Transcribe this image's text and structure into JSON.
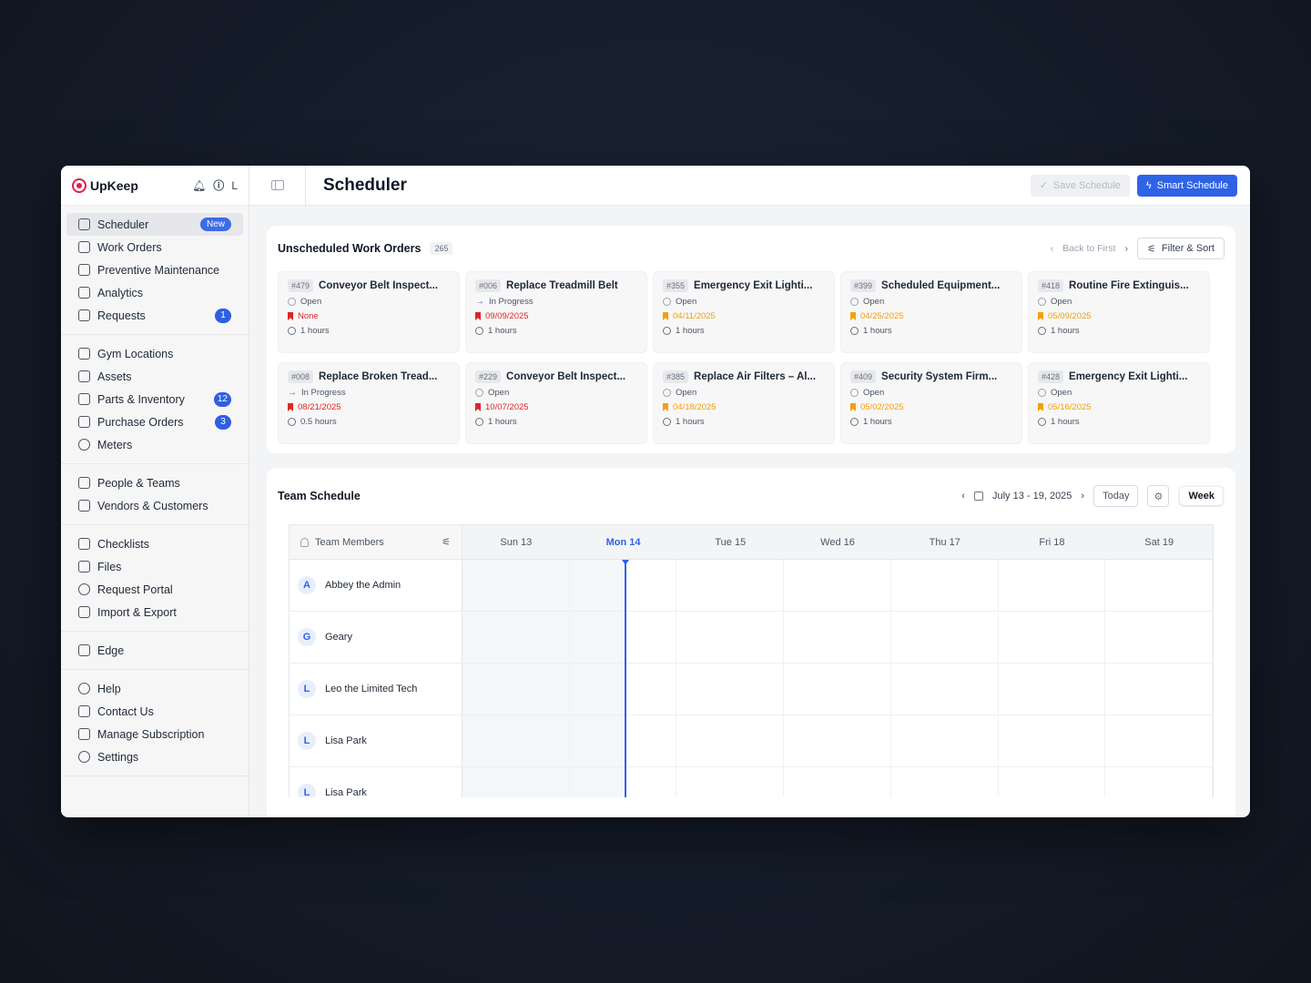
{
  "app": {
    "name": "UpKeep",
    "user_initial": "L"
  },
  "topbar": {
    "title": "Scheduler",
    "save_label": "Save Schedule",
    "smart_label": "Smart Schedule"
  },
  "sidebar": {
    "group1": [
      {
        "label": "Scheduler",
        "badge": "New",
        "active": true
      },
      {
        "label": "Work Orders"
      },
      {
        "label": "Preventive Maintenance"
      },
      {
        "label": "Analytics"
      },
      {
        "label": "Requests",
        "count": "1"
      }
    ],
    "group2": [
      {
        "label": "Gym Locations"
      },
      {
        "label": "Assets"
      },
      {
        "label": "Parts & Inventory",
        "count": "12"
      },
      {
        "label": "Purchase Orders",
        "count": "3"
      },
      {
        "label": "Meters"
      }
    ],
    "group3": [
      {
        "label": "People & Teams"
      },
      {
        "label": "Vendors & Customers"
      }
    ],
    "group4": [
      {
        "label": "Checklists"
      },
      {
        "label": "Files"
      },
      {
        "label": "Request Portal"
      },
      {
        "label": "Import & Export"
      }
    ],
    "group5": [
      {
        "label": "Edge"
      }
    ],
    "group6": [
      {
        "label": "Help"
      },
      {
        "label": "Contact Us"
      },
      {
        "label": "Manage Subscription"
      },
      {
        "label": "Settings"
      }
    ]
  },
  "unscheduled": {
    "title": "Unscheduled Work Orders",
    "count": "265",
    "back_label": "Back to First",
    "filter_label": "Filter & Sort",
    "orders": [
      {
        "id": "#479",
        "title": "Conveyor Belt Inspect...",
        "status": "Open",
        "due": "None",
        "due_color": "#dc2626",
        "hours": "1 hours"
      },
      {
        "id": "#006",
        "title": "Replace Treadmill Belt",
        "status": "In Progress",
        "due": "09/09/2025",
        "due_color": "#dc2626",
        "hours": "1 hours"
      },
      {
        "id": "#355",
        "title": "Emergency Exit Lighti...",
        "status": "Open",
        "due": "04/11/2025",
        "due_color": "#f59e0b",
        "hours": "1 hours"
      },
      {
        "id": "#399",
        "title": "Scheduled Equipment...",
        "status": "Open",
        "due": "04/25/2025",
        "due_color": "#f59e0b",
        "hours": "1 hours"
      },
      {
        "id": "#418",
        "title": "Routine Fire Extinguis...",
        "status": "Open",
        "due": "05/09/2025",
        "due_color": "#f59e0b",
        "hours": "1 hours"
      },
      {
        "id": "#008",
        "title": "Replace Broken Tread...",
        "status": "In Progress",
        "due": "08/21/2025",
        "due_color": "#dc2626",
        "hours": "0.5 hours"
      },
      {
        "id": "#229",
        "title": "Conveyor Belt Inspect...",
        "status": "Open",
        "due": "10/07/2025",
        "due_color": "#dc2626",
        "hours": "1 hours"
      },
      {
        "id": "#385",
        "title": "Replace Air Filters – Al...",
        "status": "Open",
        "due": "04/18/2025",
        "due_color": "#f59e0b",
        "hours": "1 hours"
      },
      {
        "id": "#409",
        "title": "Security System Firm...",
        "status": "Open",
        "due": "05/02/2025",
        "due_color": "#f59e0b",
        "hours": "1 hours"
      },
      {
        "id": "#428",
        "title": "Emergency Exit Lighti...",
        "status": "Open",
        "due": "05/16/2025",
        "due_color": "#f59e0b",
        "hours": "1 hours"
      }
    ]
  },
  "schedule": {
    "title": "Team Schedule",
    "range": "July 13 - 19, 2025",
    "today_label": "Today",
    "view_label": "Week",
    "members_header": "Team Members",
    "days": [
      "Sun 13",
      "Mon 14",
      "Tue 15",
      "Wed 16",
      "Thu 17",
      "Fri 18",
      "Sat 19"
    ],
    "today_index": 1,
    "members": [
      {
        "initial": "A",
        "name": "Abbey the Admin"
      },
      {
        "initial": "G",
        "name": "Geary"
      },
      {
        "initial": "L",
        "name": "Leo the Limited Tech"
      },
      {
        "initial": "L",
        "name": "Lisa Park"
      },
      {
        "initial": "L",
        "name": "Lisa Park"
      }
    ]
  },
  "colors": {
    "accent": "#2f63e6",
    "overdue": "#dc2626",
    "upcoming": "#f59e0b"
  }
}
